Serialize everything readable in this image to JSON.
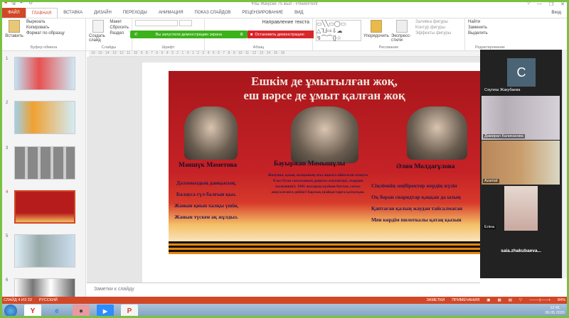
{
  "window": {
    "title": "Ұлы Жеңіске 75 жыл - PowerPoint",
    "help": "?",
    "minimize": "—",
    "maximize": "❐",
    "close": "✕",
    "sign_in": "Вход"
  },
  "tabs": [
    {
      "label": "ФАЙЛ"
    },
    {
      "label": "ГЛАВНАЯ"
    },
    {
      "label": "ВСТАВКА"
    },
    {
      "label": "ДИЗАЙН"
    },
    {
      "label": "ПЕРЕХОДЫ"
    },
    {
      "label": "АНИМАЦИЯ"
    },
    {
      "label": "ПОКАЗ СЛАЙДОВ"
    },
    {
      "label": "РЕЦЕНЗИРОВАНИЕ"
    },
    {
      "label": "ВИД"
    }
  ],
  "ribbon": {
    "clipboard": {
      "paste": "Вставить",
      "cut": "Вырезать",
      "copy": "Копировать",
      "format_painter": "Формат по образцу",
      "label": "Буфер обмена"
    },
    "slides": {
      "new_slide": "Создать слайд",
      "layout": "Макет",
      "reset": "Сбросить",
      "section": "Раздел",
      "label": "Слайды"
    },
    "font": {
      "label": "Шрифт"
    },
    "paragraph": {
      "text_direction": "Направление текста",
      "label": "Абзац"
    },
    "drawing": {
      "arrange": "Упорядочить",
      "quick_styles": "Экспресс-стили",
      "shape_fill": "Заливка фигуры",
      "shape_outline": "Контур фигуры",
      "shape_effects": "Эффекты фигуры",
      "label": "Рисование"
    },
    "editing": {
      "find": "Найти",
      "replace": "Заменить",
      "select": "Выделить",
      "label": "Редактирование"
    }
  },
  "screen_share": {
    "message": "Вы запустили демонстрацию экрана",
    "stop": "Остановить демонстрацию"
  },
  "thumbnails": [
    {
      "num": "1"
    },
    {
      "num": "2"
    },
    {
      "num": "3"
    },
    {
      "num": "4",
      "selected": true
    },
    {
      "num": "5"
    },
    {
      "num": "6"
    }
  ],
  "slide": {
    "title_line1": "Ешкім де ұмытылған жоқ,",
    "title_line2": "еш нәрсе де ұмыт қалған жоқ",
    "heroes": [
      {
        "name": "Мәншүк Мәметова",
        "lines": [
          "Даламыздың данқысың,",
          "Балауса гүл балғын қыз.",
          "Жанын қиып халқы үшін,",
          "Жанын түскен ақ жұлдыз."
        ]
      },
      {
        "name": "Бауыржан Момышұлы",
        "bio": "Жазушы, қазақ халқының аты аңызға айналған атақты Ұлы Отан соғысының даңқты жауынгері, гвардия полковнигі. 1941 жылдың күзінен бастап, соғыс аяқталғанға дейінгі барлық шайқастарға қатысқан."
      },
      {
        "name": "Әлия Молдағұлова",
        "lines": [
          "Сіңлімнің зеңбіректер жердің жүзін",
          "Оқ боран снарядтар қаққан да ызың",
          "Қаптаған қалың жаудан тайсалмаған",
          "Мен көрдім пилоткалы қатаң қызын"
        ]
      }
    ]
  },
  "notes_placeholder": "Заметки к слайду",
  "zoom_participants": [
    {
      "name": "Сәулеш Жакубаева",
      "initial": "С"
    },
    {
      "name": "Дамирал Калиханова"
    },
    {
      "name": "Azamat"
    },
    {
      "name": "Еліна"
    },
    {
      "name": "saia.zhakubaeva..."
    }
  ],
  "status": {
    "slide": "СЛАЙД 4 ИЗ 33",
    "language": "РУССКИЙ",
    "notes": "ЗАМЕТКИ",
    "comments": "ПРИМЕЧАНИЯ",
    "zoom": "84%"
  },
  "taskbar": {
    "time": "12:41",
    "date": "06.05.2020"
  },
  "colors": {
    "accent": "#d24726",
    "share_green": "#3cb21a",
    "stop_red": "#d8262b",
    "frame_green": "#7ac142"
  }
}
